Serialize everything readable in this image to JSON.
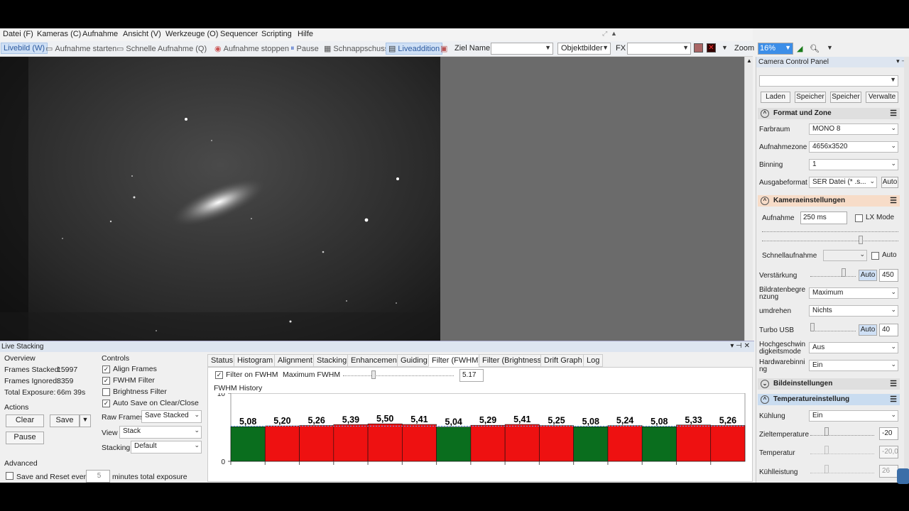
{
  "menu": [
    "Datei (F)",
    "Kameras (C)",
    "Aufnahme",
    "Ansicht (V)",
    "Werkzeuge (O)",
    "Sequencer",
    "Scripting",
    "Hilfe"
  ],
  "toolbar": {
    "livebild": "Livebild (W)",
    "aufnahme_starten": "Aufnahme starten",
    "schnelle": "Schnelle Aufnahme (Q)",
    "stoppen": "Aufnahme stoppen",
    "pause": "Pause",
    "schnappschuss": "Schnappschuss",
    "liveaddition": "Liveaddition",
    "ziel_name": "Ziel Name",
    "ziel_value": "",
    "objekt": "Objektbilder",
    "fx": "FX",
    "fx_value": "",
    "zoom": "Zoom",
    "zoom_value": "16%"
  },
  "ccp": {
    "title": "Camera Control Panel",
    "top_buttons": [
      "Laden",
      "Speicher",
      "Speicher",
      "Verwalte"
    ],
    "format_section": "Format und Zone",
    "farbraum_label": "Farbraum",
    "farbraum": "MONO 8",
    "zone_label": "Aufnahmezone",
    "zone": "4656x3520",
    "binning_label": "Binning",
    "binning": "1",
    "ausgabe_label": "Ausgabeformat",
    "ausgabe": "SER Datei (* .s...",
    "auto": "Auto",
    "kamera_section": "Kameraeinstellungen",
    "aufnahme_label": "Aufnahme",
    "aufnahme": "250 ms",
    "lx_mode": "LX Mode",
    "schnell_label": "Schnellaufnahme",
    "schnell_auto": "Auto",
    "verstaerkung_label": "Verstärkung",
    "verstaerkung": "450",
    "bildraten_label": "Bildratenbegrenzung",
    "bildraten": "Maximum",
    "umdrehen_label": "umdrehen",
    "umdrehen": "Nichts",
    "turbo_label": "Turbo USB",
    "turbo": "40",
    "hochgesch_label": "Hochgeschwindigkeitsmode",
    "hochgesch": "Aus",
    "hardware_label": "Hardwarebinning",
    "hardware": "Ein",
    "bild_section": "Bildeinstellungen",
    "temp_section": "Temperatureinstellung",
    "kuehlung_label": "Kühlung",
    "kuehlung": "Ein",
    "zieltemp_label": "Zieltemperature",
    "zieltemp": "-20",
    "temperatur_label": "Temperatur",
    "temperatur": "-20,0",
    "kuehlleistung_label": "Kühlleistung",
    "kuehlleistung": "26"
  },
  "ls": {
    "title": "Live Stacking",
    "overview": "Overview",
    "frames_stacked_label": "Frames Stacked:",
    "frames_stacked": "15997",
    "frames_ignored_label": "Frames Ignored:",
    "frames_ignored": "8359",
    "total_exposure_label": "Total Exposure:",
    "total_exposure": "66m 39s",
    "actions": "Actions",
    "clear": "Clear",
    "save": "Save",
    "pause": "Pause",
    "advanced": "Advanced",
    "save_reset": "Save and Reset every",
    "save_reset_value": "5",
    "minutes": "minutes total exposure",
    "controls": "Controls",
    "align": "Align Frames",
    "fwhm": "FWHM Filter",
    "brightness": "Brightness Filter",
    "autosave": "Auto Save on Clear/Close",
    "raw_label": "Raw Frames",
    "raw": "Save Stacked",
    "view_label": "View",
    "view": "Stack",
    "stacking_label": "Stacking",
    "stacking": "Default",
    "tabs": [
      "Status",
      "Histogram",
      "Alignment",
      "Stacking",
      "Enhancement",
      "Guiding",
      "Filter (FWHM)",
      "Filter (Brightness)",
      "Drift Graph",
      "Log"
    ],
    "filter_on": "Filter on FWHM",
    "max_fwhm_label": "Maximum FWHM",
    "max_fwhm": "5.17",
    "history": "FWHM History"
  },
  "chart_data": {
    "type": "bar",
    "title": "FWHM History",
    "ylim": [
      0,
      10
    ],
    "yticks": [
      0,
      10
    ],
    "threshold": 5.17,
    "values": [
      5.08,
      5.2,
      5.26,
      5.39,
      5.5,
      5.41,
      5.04,
      5.29,
      5.41,
      5.25,
      5.08,
      5.24,
      5.08,
      5.33,
      5.26
    ],
    "labels": [
      "5,08",
      "5,20",
      "5,26",
      "5,39",
      "5,50",
      "5,41",
      "5,04",
      "5,29",
      "5,41",
      "5,25",
      "5,08",
      "5,24",
      "5,08",
      "5,33",
      "5,26"
    ],
    "colors": {
      "pass": "#0a6e1e",
      "fail": "#ee1111"
    }
  }
}
